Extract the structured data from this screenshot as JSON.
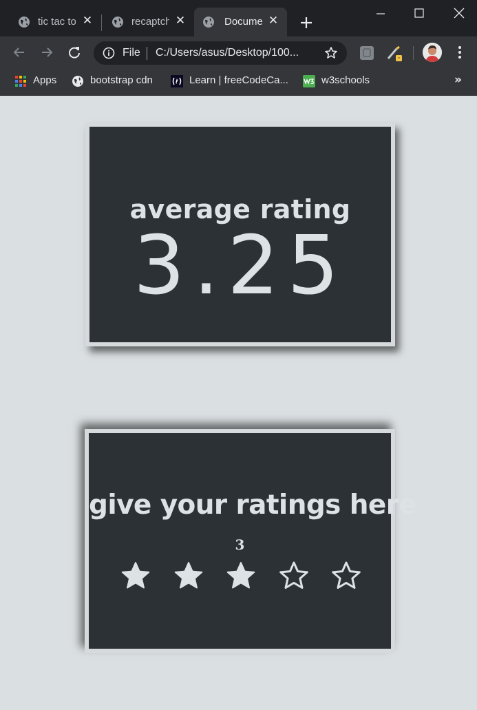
{
  "browser": {
    "tabs": [
      {
        "title": "tic tac toe",
        "active": false
      },
      {
        "title": "recaptcha",
        "active": false
      },
      {
        "title": "Document",
        "active": true
      }
    ],
    "omnibox": {
      "scheme_label": "File",
      "url": "C:/Users/asus/Desktop/100..."
    },
    "bookmarks": [
      {
        "label": "Apps",
        "icon": "apps-grid-icon"
      },
      {
        "label": "bootstrap cdn",
        "icon": "globe-icon"
      },
      {
        "label": "Learn | freeCodeCa...",
        "icon": "freecodecamp-icon"
      },
      {
        "label": "w3schools",
        "icon": "w3schools-icon"
      }
    ],
    "bookmarks_overflow": "»"
  },
  "average_card": {
    "title": "average rating",
    "value": "3.25"
  },
  "rating_card": {
    "title": "give your ratings here",
    "current_value": "3",
    "rating": 3,
    "max_rating": 5
  },
  "colors": {
    "page_background": "#dadfe1",
    "card_background": "#2b3134",
    "card_border": "#d6dadc",
    "text": "#dde2e5",
    "star": "#dde2e5"
  }
}
